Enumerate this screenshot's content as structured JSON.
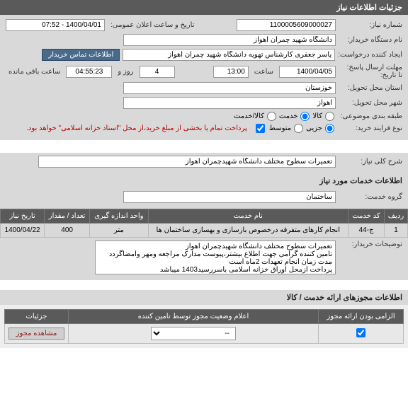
{
  "header": {
    "title": "جزئیات اطلاعات نیاز"
  },
  "fields": {
    "need_no_label": "شماره نیاز:",
    "need_no": "1100005609000027",
    "public_date_label": "تاریخ و ساعت اعلان عمومی:",
    "public_date": "1400/04/01 - 07:52",
    "buyer_org_label": "نام دستگاه خریدار:",
    "buyer_org": "دانشگاه شهید چمران اهواز",
    "creator_label": "ایجاد کننده درخواست:",
    "creator": "یاسر جعفری کارشناس تهویه دانشگاه شهید چمران اهواز",
    "contact_btn": "اطلاعات تماس خریدار",
    "deadline_label": "مهلت ارسال پاسخ:\nتا تاریخ:",
    "deadline_date": "1400/04/05",
    "hour_label": "ساعت",
    "deadline_hour": "13:00",
    "days_left": "4",
    "days_label": "روز و",
    "time_left": "04:55:23",
    "remain_label": "ساعت باقی مانده",
    "province_label": "استان محل تحویل:",
    "province": "خوزستان",
    "city_label": "شهر محل تحویل:",
    "city": "اهواز",
    "category_label": "طبقه بندی موضوعی:",
    "radio_goods": "کالا",
    "radio_service": "خدمت",
    "radio_goods_service": "کالا/خدمت",
    "purchase_type_label": "نوع فرایند خرید:",
    "radio_partial": "جزیی",
    "radio_medium": "متوسط",
    "purchase_hint": "پرداخت تمام یا بخشی از مبلغ خرید،از محل \"اسناد خزانه اسلامی\" خواهد بود.",
    "desc_label": "شرح کلی نیاز:",
    "desc": "تعمیرات سطوح مختلف دانشگاه شهیدچمران اهواز"
  },
  "services_section": {
    "title": "اطلاعات خدمات مورد نیاز",
    "group_label": "گروه خدمت:",
    "group_value": "ساختمان"
  },
  "service_table": {
    "headers": [
      "ردیف",
      "کد خدمت",
      "نام خدمت",
      "واحد اندازه گیری",
      "تعداد / مقدار",
      "تاریخ نیاز"
    ],
    "rows": [
      {
        "idx": "1",
        "code": "ج-44",
        "name": "انجام کارهای متفرقه درخصوص بازسازی و بهسازی ساختمان ها",
        "unit": "متر",
        "qty": "400",
        "date": "1400/04/22"
      }
    ]
  },
  "buyer_notes": {
    "label": "توضیحات خریدار:",
    "text": "تعمیرات سطوح مختلف دانشگاه شهیدچمران اهواز\nتامین کننده گرامی جهت اطلاع بیشتر،پیوست مدارک مراجعه ومهر وامضاگردد\nمدت زمان انجام تعهدات 2ماه است\nپرداخت ازمحل اوراق خزانه اسلامی باسررسید1403 میباشد"
  },
  "permits_section": {
    "title": "اطلاعات مجوزهای ارائه خدمت / کالا"
  },
  "permits_table": {
    "headers": [
      "الزامی بودن ارائه مجوز",
      "اعلام وضعیت مجوز توسط تامین کننده",
      "جزئیات"
    ],
    "row": {
      "mandatory_checked": true,
      "status": "--",
      "view_btn": "مشاهده مجوز"
    }
  }
}
